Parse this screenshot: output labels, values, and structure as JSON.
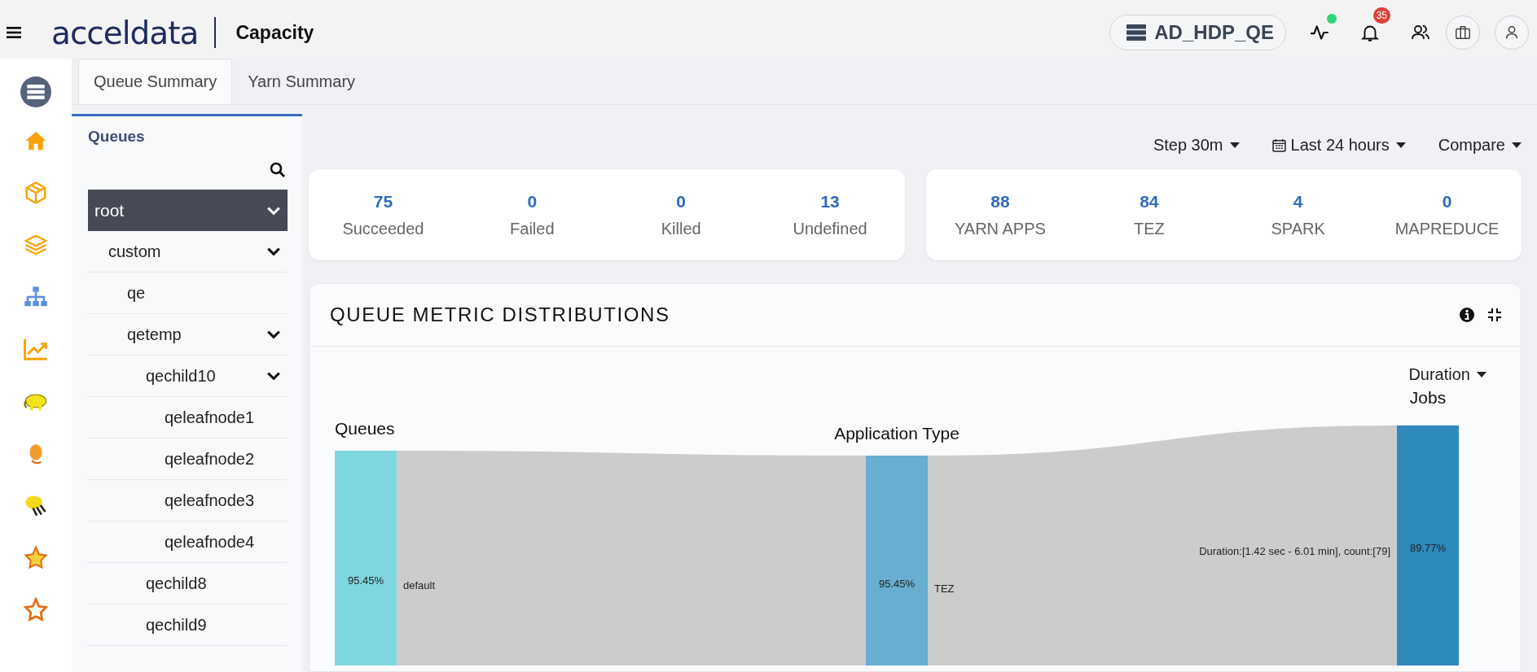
{
  "header": {
    "logo": "acceldata",
    "page_title": "Capacity",
    "cluster": "AD_HDP_QE",
    "health_ok": true,
    "notification_count": "35"
  },
  "tabs": [
    {
      "label": "Queue Summary",
      "selected": true
    },
    {
      "label": "Yarn Summary",
      "selected": false
    }
  ],
  "queues": {
    "title": "Queues",
    "tree": [
      {
        "name": "root",
        "selected": true,
        "expanded": true,
        "children": [
          {
            "name": "custom",
            "selected": false,
            "expanded": true,
            "children": [
              {
                "name": "qe",
                "selected": false
              },
              {
                "name": "qetemp",
                "selected": false,
                "expanded": true,
                "children": [
                  {
                    "name": "qechild10",
                    "selected": false,
                    "expanded": true,
                    "children": [
                      {
                        "name": "qeleafnode1",
                        "selected": false
                      },
                      {
                        "name": "qeleafnode2",
                        "selected": false
                      },
                      {
                        "name": "qeleafnode3",
                        "selected": false
                      },
                      {
                        "name": "qeleafnode4",
                        "selected": false
                      }
                    ]
                  },
                  {
                    "name": "qechild8",
                    "selected": false
                  },
                  {
                    "name": "qechild9",
                    "selected": false
                  }
                ]
              }
            ]
          }
        ]
      }
    ]
  },
  "toolbar": {
    "step": "Step 30m",
    "range": "Last 24 hours",
    "compare": "Compare"
  },
  "status_stats": [
    {
      "value": "75",
      "label": "Succeeded"
    },
    {
      "value": "0",
      "label": "Failed"
    },
    {
      "value": "0",
      "label": "Killed"
    },
    {
      "value": "13",
      "label": "Undefined"
    }
  ],
  "app_stats": [
    {
      "value": "88",
      "label": "YARN APPS"
    },
    {
      "value": "84",
      "label": "TEZ"
    },
    {
      "value": "4",
      "label": "SPARK"
    },
    {
      "value": "0",
      "label": "MAPREDUCE"
    }
  ],
  "distribution": {
    "title": "QUEUE METRIC DISTRIBUTIONS",
    "metric": "Duration",
    "columns": [
      "Queues",
      "Application Type",
      "Jobs"
    ],
    "queue_node": {
      "percent": "95.45%",
      "label": "default"
    },
    "app_node": {
      "percent": "95.45%",
      "label": "TEZ"
    },
    "job_node": {
      "percent": "89.77%",
      "label": "Duration:[1.42 sec - 6.01 min], count:[79]"
    }
  }
}
